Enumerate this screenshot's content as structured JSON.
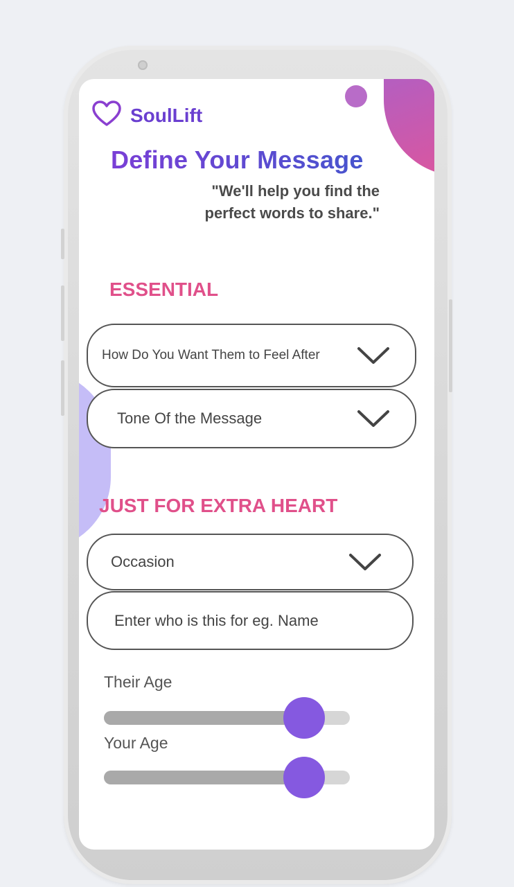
{
  "app": {
    "name": "SoulLift",
    "brand_color": "#6a3fd0",
    "accent_color": "#e0508a",
    "slider_color": "#8559e0"
  },
  "header": {
    "title": "Define Your Message",
    "subtitle": "\"We'll help you find the perfect words to share.\""
  },
  "essential": {
    "heading": "ESSENTIAL",
    "feel_dropdown": {
      "value": "How Do You Want Them to Feel After",
      "icon": "chevron-down-icon"
    },
    "tone_dropdown": {
      "value": "Tone Of the Message",
      "icon": "chevron-down-icon"
    }
  },
  "extra": {
    "heading": "JUST FOR EXTRA HEART",
    "occasion_dropdown": {
      "value": "Occasion",
      "icon": "chevron-down-icon"
    },
    "name_input": {
      "placeholder": "Enter who is this for eg. Name"
    }
  },
  "sliders": {
    "their_age": {
      "label": "Their Age",
      "fraction": 0.815
    },
    "your_age": {
      "label": "Your Age",
      "fraction": 0.815
    }
  }
}
